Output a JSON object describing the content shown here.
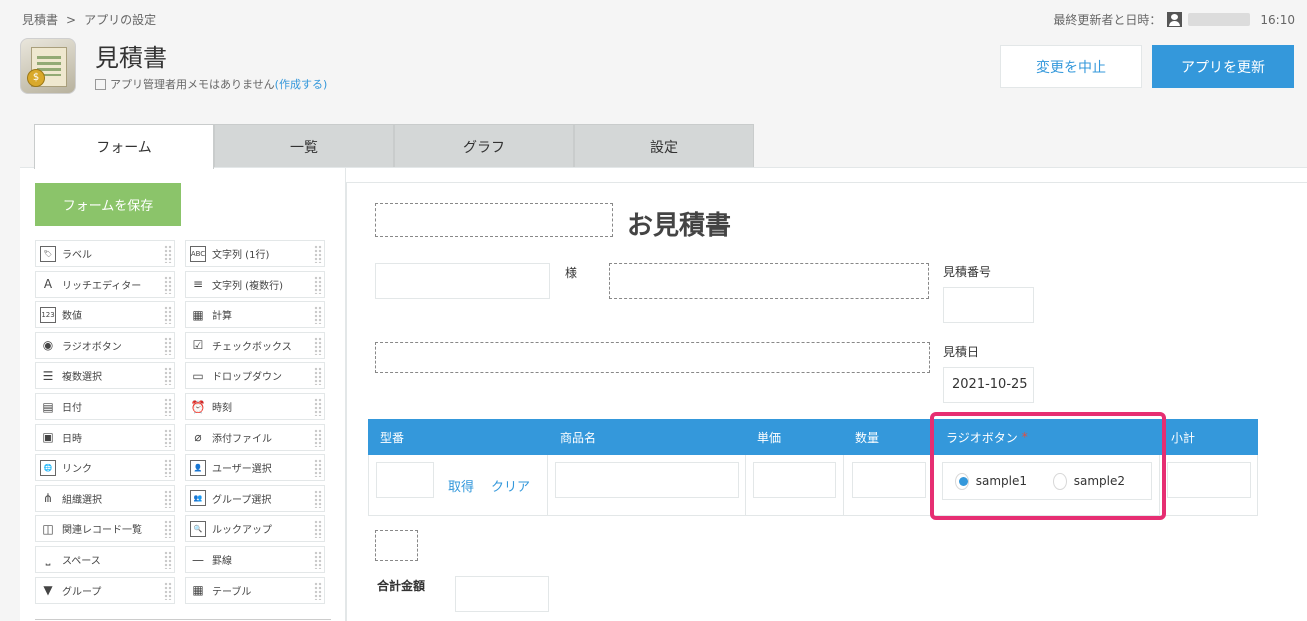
{
  "breadcrumb": {
    "app": "見積書",
    "separator": ">",
    "page": "アプリの設定"
  },
  "updater": {
    "label": "最終更新者と日時：",
    "time": "16:10"
  },
  "app": {
    "title": "見積書",
    "memo": "アプリ管理者用メモはありません",
    "memo_link": "(作成する)"
  },
  "actions": {
    "cancel": "変更を中止",
    "update": "アプリを更新"
  },
  "tabs": [
    "フォーム",
    "一覧",
    "グラフ",
    "設定"
  ],
  "palette": {
    "save": "フォームを保存",
    "items": [
      {
        "label": "ラベル",
        "icon": "tag-icon"
      },
      {
        "label": "文字列 (1行)",
        "icon": "abc-icon"
      },
      {
        "label": "リッチエディター",
        "icon": "rich-editor-icon"
      },
      {
        "label": "文字列 (複数行)",
        "icon": "multiline-icon"
      },
      {
        "label": "数値",
        "icon": "number-icon"
      },
      {
        "label": "計算",
        "icon": "calc-icon"
      },
      {
        "label": "ラジオボタン",
        "icon": "radio-icon"
      },
      {
        "label": "チェックボックス",
        "icon": "checkbox-icon"
      },
      {
        "label": "複数選択",
        "icon": "multi-select-icon"
      },
      {
        "label": "ドロップダウン",
        "icon": "dropdown-icon"
      },
      {
        "label": "日付",
        "icon": "date-icon"
      },
      {
        "label": "時刻",
        "icon": "clock-icon"
      },
      {
        "label": "日時",
        "icon": "datetime-icon"
      },
      {
        "label": "添付ファイル",
        "icon": "paperclip-icon"
      },
      {
        "label": "リンク",
        "icon": "globe-icon"
      },
      {
        "label": "ユーザー選択",
        "icon": "user-icon"
      },
      {
        "label": "組織選択",
        "icon": "org-icon"
      },
      {
        "label": "グループ選択",
        "icon": "group-icon"
      },
      {
        "label": "関連レコード一覧",
        "icon": "related-records-icon"
      },
      {
        "label": "ルックアップ",
        "icon": "lookup-icon"
      },
      {
        "label": "スペース",
        "icon": "space-icon"
      },
      {
        "label": "罫線",
        "icon": "line-icon"
      },
      {
        "label": "グループ",
        "icon": "group-field-icon"
      },
      {
        "label": "テーブル",
        "icon": "table-icon"
      }
    ]
  },
  "form": {
    "title": "お見積書",
    "honorific": "様",
    "quote_number_label": "見積番号",
    "quote_date_label": "見積日",
    "quote_date_value": "2021-10-25",
    "table_headers": [
      "型番",
      "商品名",
      "単価",
      "数量",
      "ラジオボタン",
      "小計"
    ],
    "required_mark": "*",
    "fetch_link": "取得",
    "clear_link": "クリア",
    "radio_options": [
      "sample1",
      "sample2"
    ],
    "radio_selected": "sample1",
    "total_label": "合計金額"
  },
  "colors": {
    "accent": "#3498db",
    "save": "#8bc46a",
    "highlight": "#e62e72"
  }
}
